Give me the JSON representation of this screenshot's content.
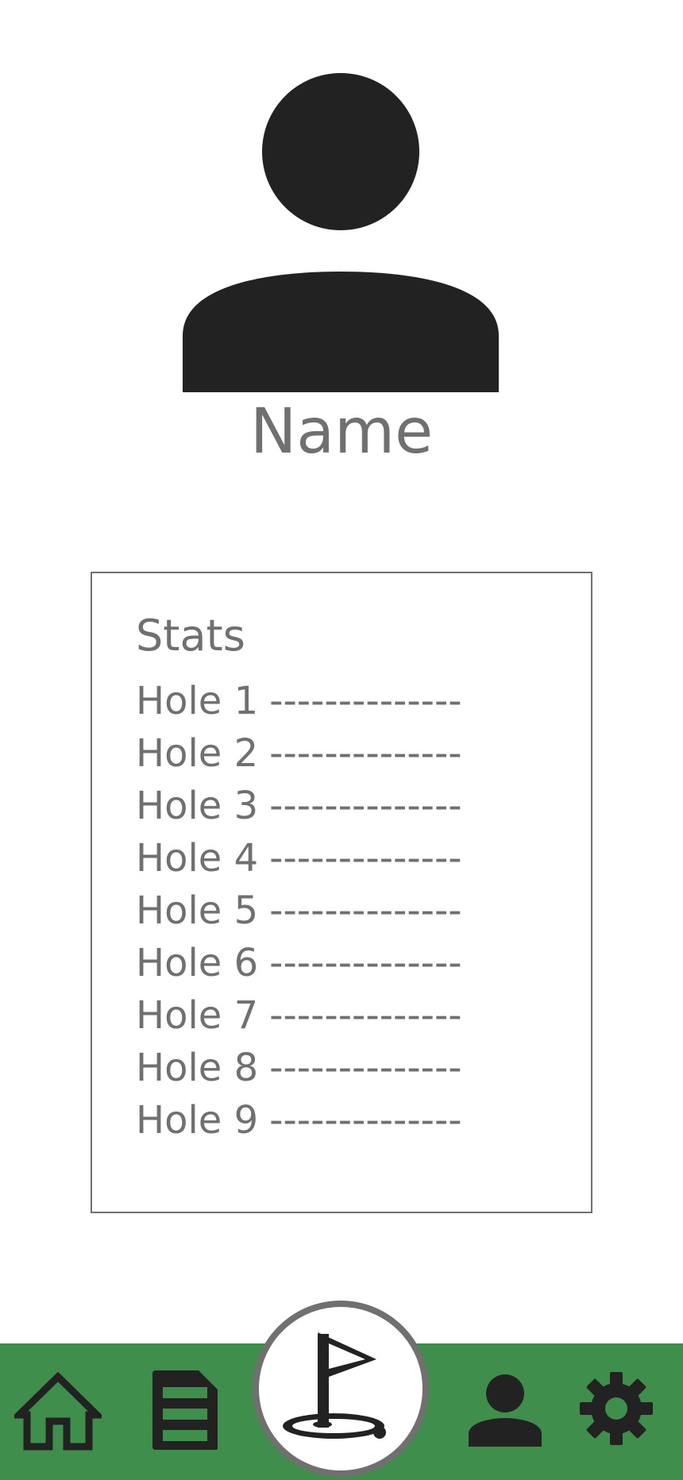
{
  "profile": {
    "name": "Name",
    "avatar_icon": "person-icon"
  },
  "stats": {
    "title": "Stats",
    "rows": [
      {
        "label": "Hole 1",
        "value": "--------------"
      },
      {
        "label": "Hole 2",
        "value": "--------------"
      },
      {
        "label": "Hole 3",
        "value": "--------------"
      },
      {
        "label": "Hole 4",
        "value": "--------------"
      },
      {
        "label": "Hole 5",
        "value": "--------------"
      },
      {
        "label": "Hole 6",
        "value": "--------------"
      },
      {
        "label": "Hole 7",
        "value": "--------------"
      },
      {
        "label": "Hole 8",
        "value": "--------------"
      },
      {
        "label": "Hole 9",
        "value": "--------------"
      }
    ]
  },
  "bottom_nav": {
    "items": [
      {
        "icon": "home-icon"
      },
      {
        "icon": "document-icon"
      },
      {
        "icon": "golf-flag-icon"
      },
      {
        "icon": "profile-icon"
      },
      {
        "icon": "gear-icon"
      }
    ]
  },
  "colors": {
    "nav_background": "#3f8e4b",
    "text_gray": "#707070",
    "icon_dark": "#222222"
  }
}
